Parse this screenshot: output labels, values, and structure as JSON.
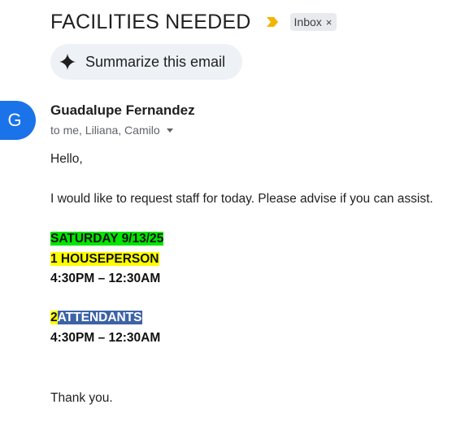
{
  "email": {
    "subject": "FACILITIES NEEDED",
    "label_chip": "Inbox",
    "label_remove": "×",
    "summarize_label": "Summarize this email",
    "avatar_initial": "G",
    "sender_name": "Guadalupe Fernandez",
    "recipients": "to me, Liliana, Camilo",
    "body": {
      "greeting": "Hello,",
      "request": "I would like to request staff for today. Please advise if you can assist.",
      "date_line": "SATURDAY 9/13/25",
      "houseperson_line": "1 HOUSEPERSON",
      "shift_1": "4:30PM – 12:30AM",
      "attendants_count": "2",
      "attendants_label": "ATTENDANTS",
      "shift_2": "4:30PM – 12:30AM",
      "closing": "Thank you."
    }
  },
  "colors": {
    "important_marker": "#f4b400",
    "avatar_bg": "#1a73e8",
    "highlight_green": "#00e600",
    "highlight_yellow": "#ffff00",
    "highlight_blue": "#3d63a6"
  },
  "icons": {
    "important": "important-marker-icon",
    "summarize": "sparkle-icon",
    "recipients_toggle": "caret-down-icon"
  }
}
